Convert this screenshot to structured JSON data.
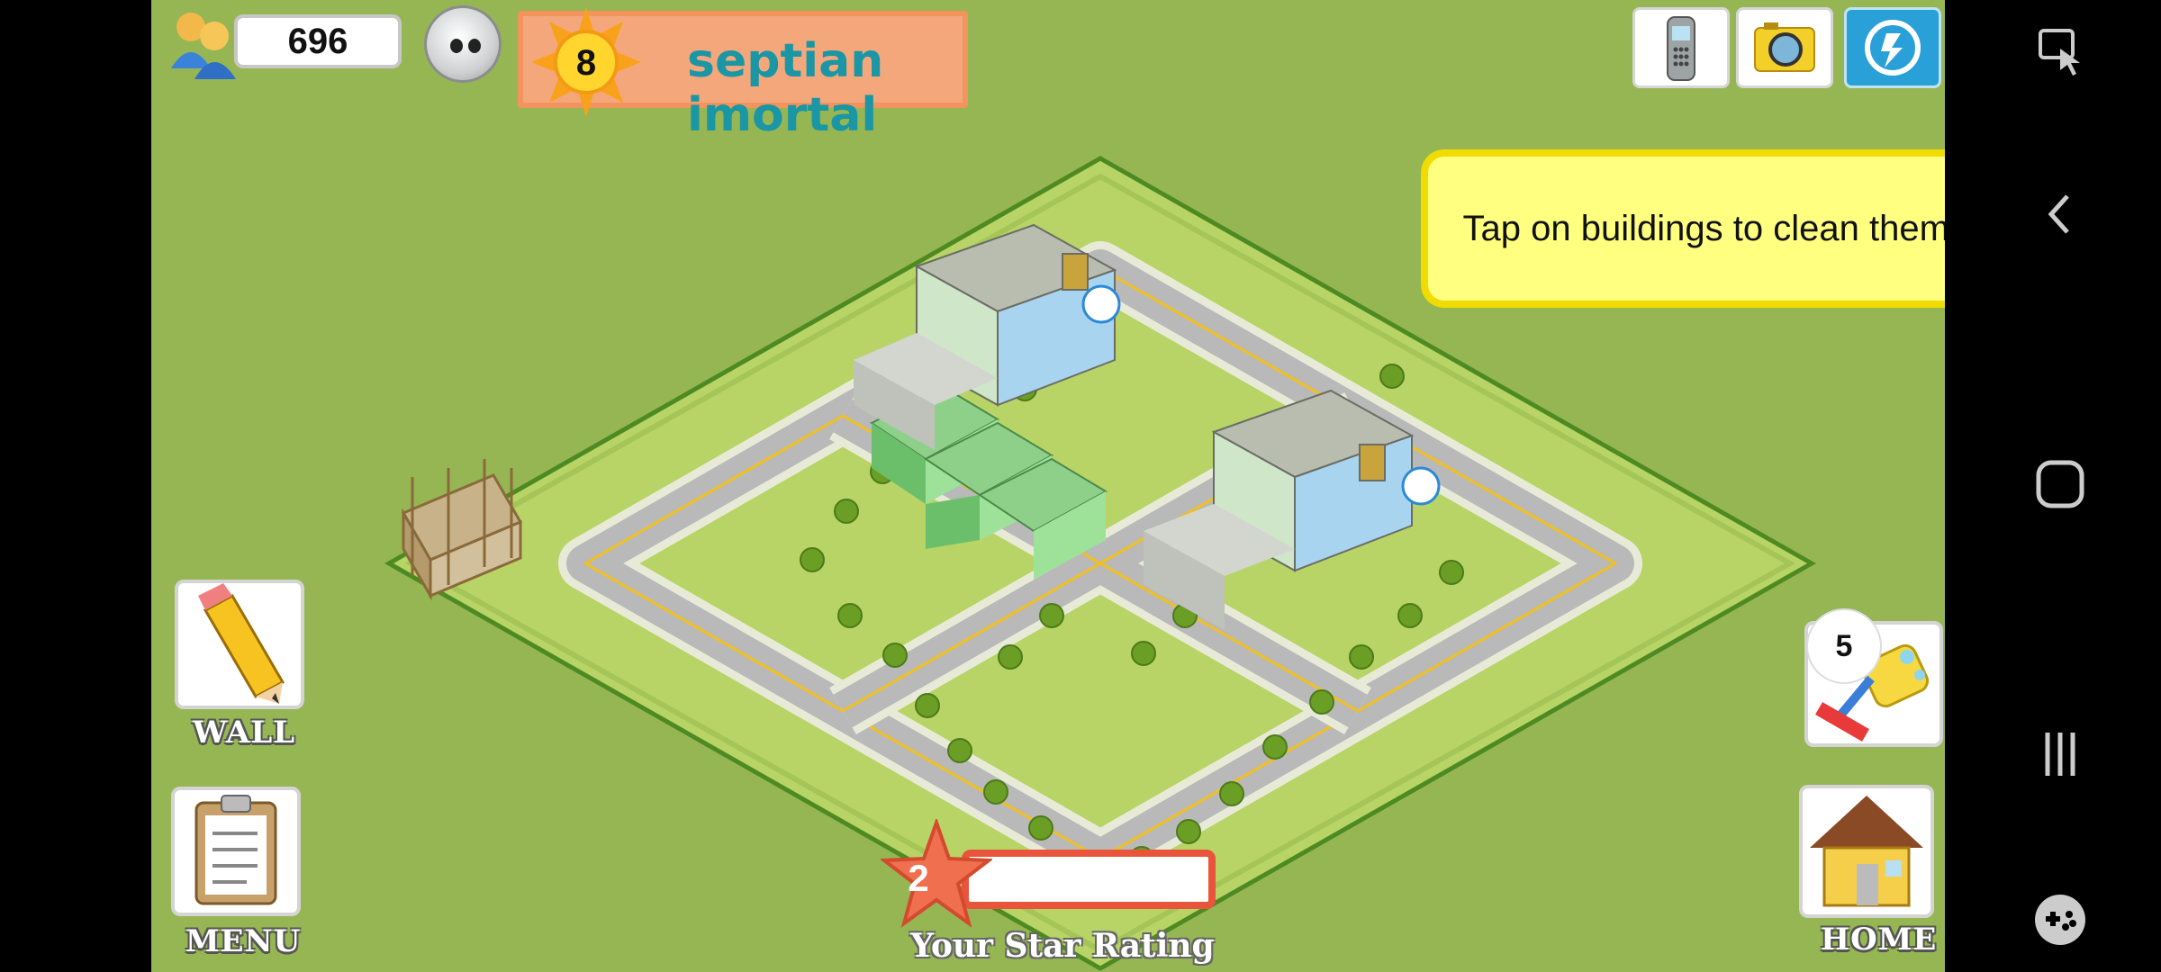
{
  "hud": {
    "population": "696",
    "level": "8",
    "player_name": "septian imortal"
  },
  "tip": {
    "text": "Tap on buildings to clean them."
  },
  "left_buttons": {
    "wall_label": "WALL",
    "menu_label": "MENU"
  },
  "right_buttons": {
    "clean_count": "5",
    "home_label": "HOME"
  },
  "star_rating": {
    "value": "2",
    "label": "Your Star Rating",
    "progress": 0
  },
  "colors": {
    "grass": "#96b654",
    "board": "#b8d466",
    "road": "#b9b9b9",
    "tip_bg": "#ffff80",
    "star": "#e9553b"
  },
  "icons": [
    "population-icon",
    "avatar-icon",
    "level-sun-icon",
    "phone-icon",
    "camera-icon",
    "share-icon",
    "pencil-icon",
    "clipboard-icon",
    "mop-icon",
    "home-icon",
    "screen-record-icon",
    "back-icon",
    "home-nav-icon",
    "recents-icon",
    "game-launcher-icon"
  ]
}
